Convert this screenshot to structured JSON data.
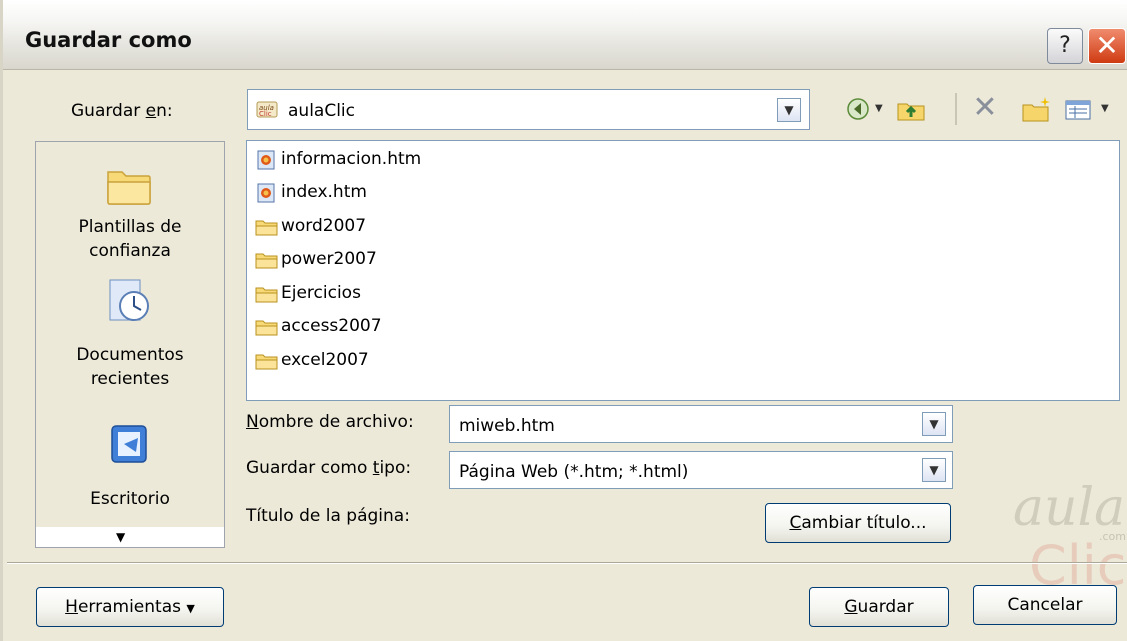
{
  "window": {
    "title": "Guardar como",
    "help_label": "?",
    "close_label": "✕"
  },
  "lookin": {
    "label_pre": "Guardar ",
    "label_ul": "e",
    "label_post": "n:",
    "value": "aulaClic"
  },
  "places": {
    "items": [
      {
        "label_line1": "Plantillas de",
        "label_line2": "confianza",
        "icon": "folder-icon"
      },
      {
        "label_line1": "Documentos",
        "label_line2": "recientes",
        "icon": "recent-documents-icon"
      },
      {
        "label_line1": "Escritorio",
        "label_line2": "",
        "icon": "desktop-icon"
      }
    ],
    "scroll_glyph": "▼"
  },
  "files": [
    {
      "name": "informacion.htm",
      "icon": "html-file-icon"
    },
    {
      "name": "index.htm",
      "icon": "html-file-icon"
    },
    {
      "name": "word2007",
      "icon": "folder-icon"
    },
    {
      "name": "power2007",
      "icon": "folder-icon"
    },
    {
      "name": "Ejercicios",
      "icon": "folder-icon"
    },
    {
      "name": "access2007",
      "icon": "folder-icon"
    },
    {
      "name": "excel2007",
      "icon": "folder-icon"
    }
  ],
  "filename": {
    "label_ul": "N",
    "label_post": "ombre de archivo:",
    "value": "miweb.htm"
  },
  "filetype": {
    "label_pre": "Guardar como ",
    "label_ul": "t",
    "label_post": "ipo:",
    "value": "Página Web (*.htm; *.html)"
  },
  "pagetitle": {
    "label": "Título de la página:",
    "button_ul": "C",
    "button_post": "ambiar título..."
  },
  "footer": {
    "tools_ul": "H",
    "tools_post": "erramientas",
    "tools_arrow": "▼",
    "save_ul": "G",
    "save_post": "uardar",
    "cancel_label": "Cancelar"
  },
  "watermark": {
    "line1": "aula",
    "line2": "Clic",
    "suffix": ".com"
  },
  "colors": {
    "dialog_bg": "#ece9d8",
    "close_red": "#cf3b12",
    "input_border": "#7f9db9",
    "button_border": "#003c74"
  }
}
